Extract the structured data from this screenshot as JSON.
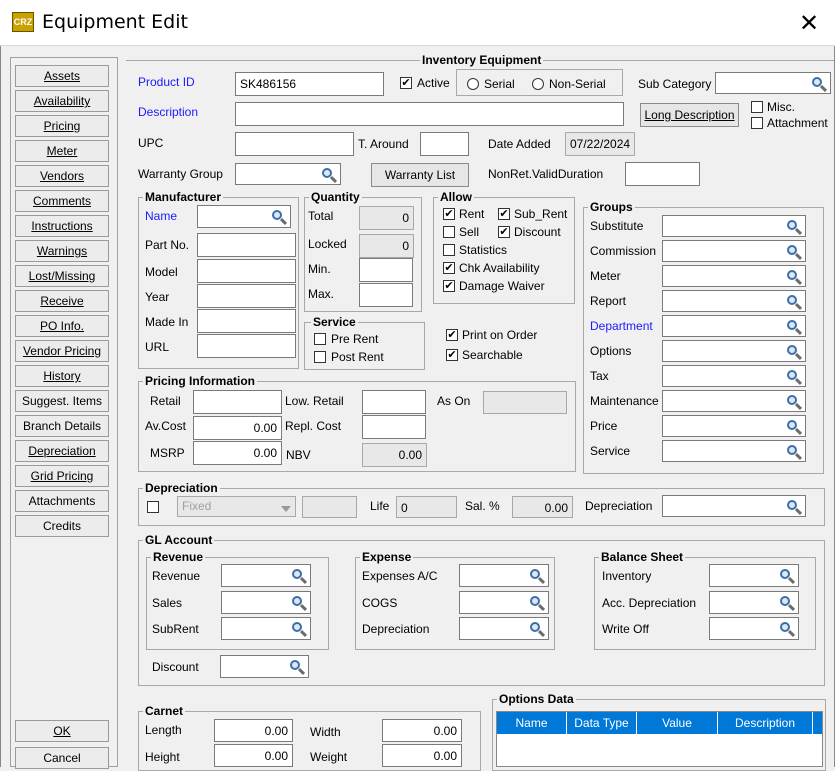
{
  "window": {
    "title": "Equipment Edit",
    "app_icon_text": "CRZ"
  },
  "nav": [
    "Assets",
    "Availability",
    "Pricing",
    "Meter",
    "Vendors",
    "Comments",
    "Instructions",
    "Warnings",
    "Lost/Missing",
    "Receive",
    "PO Info.",
    "Vendor Pricing",
    "History",
    "Suggest. Items",
    "Branch Details",
    "Depreciation",
    "Grid Pricing",
    "Attachments",
    "Credits"
  ],
  "ok_label": "OK",
  "cancel_label": "Cancel",
  "inventory": {
    "title": "Inventory Equipment",
    "product_id_label": "Product ID",
    "product_id_value": "SK486156",
    "active_label": "Active",
    "serial_label": "Serial",
    "nonserial_label": "Non-Serial",
    "subcategory_label": "Sub Category",
    "description_label": "Description",
    "long_desc_label": "Long Description",
    "misc_label": "Misc.",
    "attachment_label": "Attachment",
    "upc_label": "UPC",
    "taround_label": "T. Around",
    "date_added_label": "Date Added",
    "date_added_value": "07/22/2024",
    "warranty_group_label": "Warranty Group",
    "warranty_list_label": "Warranty List",
    "nonret_label": "NonRet.ValidDuration"
  },
  "manufacturer": {
    "title": "Manufacturer",
    "name": "Name",
    "part_no": "Part No.",
    "model": "Model",
    "year": "Year",
    "made_in": "Made In",
    "url": "URL"
  },
  "quantity": {
    "title": "Quantity",
    "total_label": "Total",
    "total_value": "0",
    "locked_label": "Locked",
    "locked_value": "0",
    "min_label": "Min.",
    "max_label": "Max."
  },
  "allow": {
    "title": "Allow",
    "rent": "Rent",
    "sub_rent": "Sub_Rent",
    "sell": "Sell",
    "discount": "Discount",
    "statistics": "Statistics",
    "chk_availability": "Chk Availability",
    "damage_waiver": "Damage Waiver",
    "check": "✔"
  },
  "service": {
    "title": "Service",
    "pre_rent": "Pre Rent",
    "post_rent": "Post Rent"
  },
  "print_on_order": "Print on Order",
  "searchable": "Searchable",
  "groups": {
    "title": "Groups",
    "items": [
      "Substitute",
      "Commission",
      "Meter",
      "Report",
      "Department",
      "Options",
      "Tax",
      "Maintenance",
      "Price",
      "Service"
    ]
  },
  "pricing": {
    "title": "Pricing Information",
    "retail": "Retail",
    "av_cost_label": "Av.Cost",
    "av_cost_value": "0.00",
    "msrp_label": "MSRP",
    "msrp_value": "0.00",
    "low_retail": "Low. Retail",
    "repl_cost": "Repl. Cost",
    "nbv_label": "NBV",
    "nbv_value": "0.00",
    "as_on": "As On"
  },
  "depreciation": {
    "title": "Depreciation",
    "method": "Fixed",
    "life_label": "Life",
    "life_value": "0",
    "sal_label": "Sal. %",
    "sal_value": "0.00",
    "dep_label": "Depreciation"
  },
  "gl": {
    "title": "GL Account",
    "revenue_title": "Revenue",
    "revenue": "Revenue",
    "sales": "Sales",
    "subrent": "SubRent",
    "expense_title": "Expense",
    "expenses_ac": "Expenses A/C",
    "cogs": "COGS",
    "depreciation": "Depreciation",
    "balance_title": "Balance Sheet",
    "inventory": "Inventory",
    "acc_depreciation": "Acc. Depreciation",
    "write_off": "Write Off",
    "discount": "Discount"
  },
  "carnet": {
    "title": "Carnet",
    "length_label": "Length",
    "length_value": "0.00",
    "width_label": "Width",
    "width_value": "0.00",
    "height_label": "Height",
    "height_value": "0.00",
    "weight_label": "Weight",
    "weight_value": "0.00"
  },
  "options_data": {
    "title": "Options Data",
    "columns": [
      "Name",
      "Data Type",
      "Value",
      "Description"
    ]
  }
}
